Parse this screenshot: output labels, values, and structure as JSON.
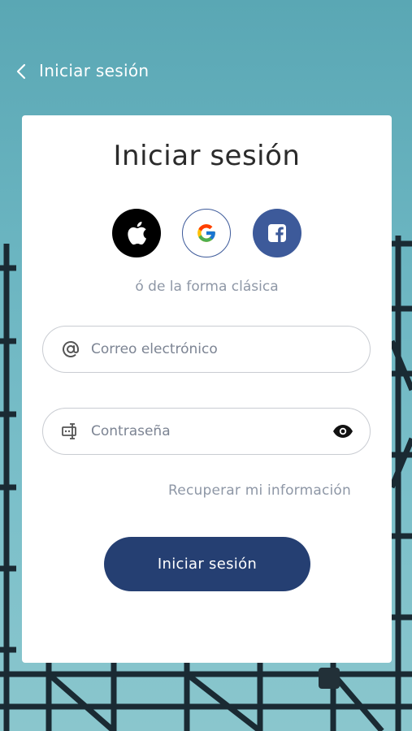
{
  "header": {
    "title": "Iniciar sesión",
    "back_icon": "chevron-left-icon"
  },
  "card": {
    "title": "Iniciar sesión",
    "social": [
      {
        "name": "apple",
        "icon": "apple-icon",
        "color": "#000000"
      },
      {
        "name": "google",
        "icon": "google-icon",
        "color": "#ffffff"
      },
      {
        "name": "facebook",
        "icon": "facebook-icon",
        "color": "#3d5a9a"
      }
    ],
    "subtitle": "ó de la forma clásica",
    "email": {
      "placeholder": "Correo electrónico",
      "value": "",
      "icon": "at-icon"
    },
    "password": {
      "placeholder": "Contraseña",
      "value": "",
      "icon": "password-field-icon",
      "toggle_icon": "eye-icon"
    },
    "recover_link": "Recuperar mi información",
    "submit_label": "Iniciar sesión"
  },
  "colors": {
    "accent": "#253f72",
    "facebook": "#3d5a9a",
    "muted_text": "#8e97a6"
  }
}
